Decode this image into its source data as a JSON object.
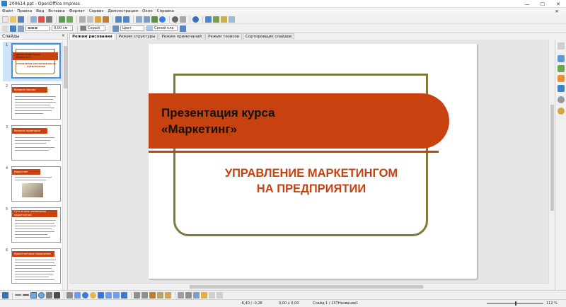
{
  "window": {
    "title": "200614.ppt - OpenOffice Impress",
    "minimize": "—",
    "maximize": "☐",
    "close": "✕"
  },
  "menu": [
    "Файл",
    "Правка",
    "Вид",
    "Вставка",
    "Формат",
    "Сервис",
    "Демонстрация",
    "Окно",
    "Справка"
  ],
  "toolbar2": {
    "line_width": "0,00 см",
    "line_color": "Серый",
    "area_style": "Цвет",
    "area_color": "Синий кла"
  },
  "slides_pane": {
    "title": "Слайды",
    "close": "×",
    "thumbnails": [
      {
        "number": "1",
        "title": "Презентация курса «Маркетинг»",
        "subtitle": "УПРАВЛЕНИЕ МАРКЕТИНГОМ НА ПРЕДПРИЯТИИ"
      },
      {
        "number": "2",
        "title": "Вопросы лекции"
      },
      {
        "number": "3",
        "title": "Вопросы аудитории"
      },
      {
        "number": "4",
        "title": "Маркетинг"
      },
      {
        "number": "5",
        "title": "Суть и цель управления маркетингом"
      },
      {
        "number": "6",
        "title": "Маркетинговое управление"
      }
    ]
  },
  "view_tabs": [
    {
      "label": "Режим рисования",
      "active": true
    },
    {
      "label": "Режим структуры",
      "active": false
    },
    {
      "label": "Режим примечаний",
      "active": false
    },
    {
      "label": "Режим тезисов",
      "active": false
    },
    {
      "label": "Сортировщик слайдов",
      "active": false
    }
  ],
  "slide": {
    "title": "Презентация курса\n«Маркетинг»",
    "subtitle": "УПРАВЛЕНИЕ МАРКЕТИНГОМ\nНА ПРЕДПРИЯТИИ"
  },
  "status": {
    "position": "-6,40 / -0,28",
    "size": "0,00 x 0,00",
    "slide": "Слайд 1 / 137",
    "layout": "Название1",
    "zoom": "112 %"
  },
  "colors": {
    "accent_orange": "#c8420f",
    "frame_olive": "#7d7a3b",
    "selection_blue": "#4a90d9"
  }
}
